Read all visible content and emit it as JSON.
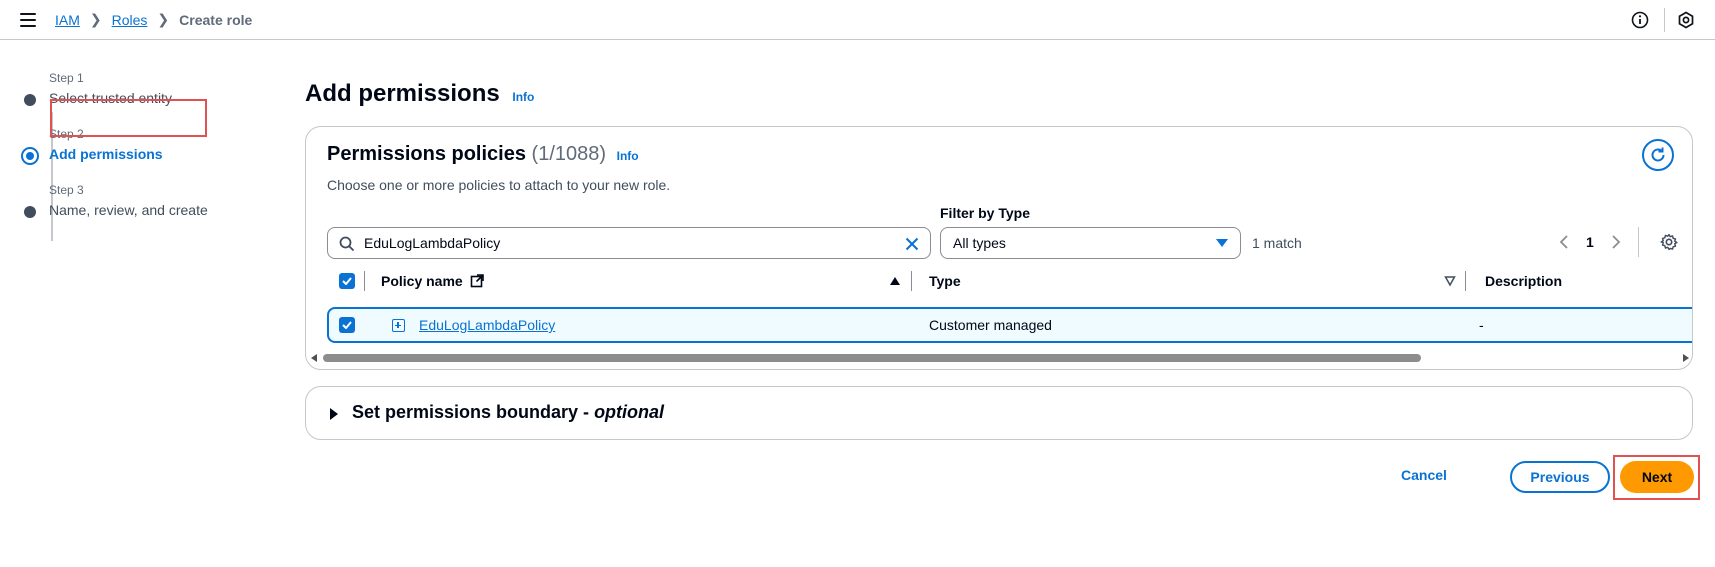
{
  "breadcrumb": {
    "items": [
      "IAM",
      "Roles"
    ],
    "current": "Create role"
  },
  "steps": [
    {
      "small": "Step 1",
      "label": "Select trusted entity"
    },
    {
      "small": "Step 2",
      "label": "Add permissions"
    },
    {
      "small": "Step 3",
      "label": "Name, review, and create"
    }
  ],
  "page": {
    "title": "Add permissions",
    "info": "Info"
  },
  "policies": {
    "title": "Permissions policies",
    "count": "(1/1088)",
    "info": "Info",
    "description": "Choose one or more policies to attach to your new role.",
    "search_value": "EduLogLambdaPolicy",
    "filter_label": "Filter by Type",
    "filter_value": "All types",
    "match_text": "1 match",
    "page_number": "1",
    "columns": {
      "policy_name": "Policy name",
      "type": "Type",
      "description": "Description"
    },
    "rows": [
      {
        "name": "EduLogLambdaPolicy",
        "type": "Customer managed",
        "description": "-"
      }
    ]
  },
  "boundary": {
    "label_main": "Set permissions boundary - ",
    "label_optional": "optional"
  },
  "actions": {
    "cancel": "Cancel",
    "previous": "Previous",
    "next": "Next"
  },
  "colors": {
    "accent": "#0972d3",
    "primary_button": "#ff9900",
    "highlight": "#e05252"
  }
}
